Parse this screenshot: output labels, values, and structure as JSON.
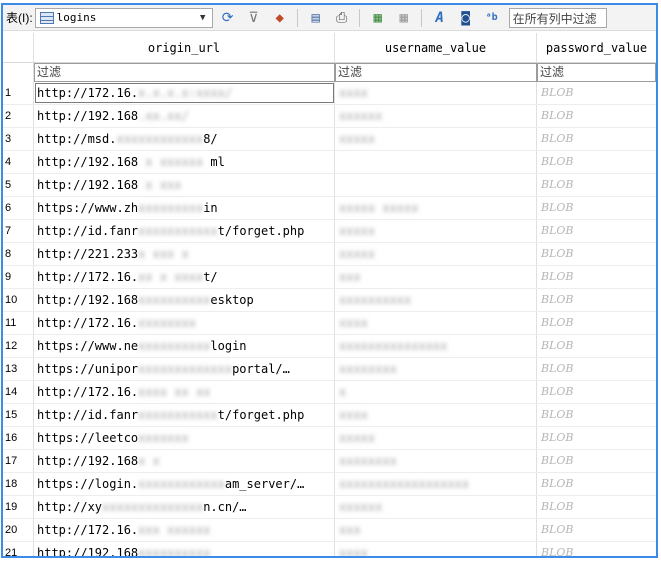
{
  "toolbar": {
    "table_label": "表(I):",
    "table_name": "logins",
    "filter_all_placeholder": "在所有列中过滤",
    "icons": [
      "refresh-icon",
      "clear-filter-icon",
      "save-filter-icon",
      "print-preview-icon",
      "print-icon",
      "new-record-icon",
      "delete-record-icon",
      "text-style-icon",
      "export-icon",
      "find-icon"
    ]
  },
  "grid": {
    "columns": [
      "origin_url",
      "username_value",
      "password_value"
    ],
    "filter_placeholder": "过滤",
    "rows": [
      {
        "id": "1",
        "origin_url": "http://172.16.",
        "origin_url_blur": "x.x.x.x:xxxx/",
        "username": "xxxx",
        "password": "BLOB"
      },
      {
        "id": "2",
        "origin_url": "http://192.168",
        "origin_url_blur": ".xx.xx/",
        "username": "xxxxxx",
        "password": "BLOB"
      },
      {
        "id": "3",
        "origin_url": "http://msd.",
        "origin_url_blur": "xxxxxxxxxxxx",
        "origin_url_tail": "8/",
        "username": "xxxxx",
        "password": "BLOB"
      },
      {
        "id": "4",
        "origin_url": "http://192.168",
        "origin_url_blur": " x xxxxxx ",
        "origin_url_tail": "ml",
        "username": "",
        "password": "BLOB"
      },
      {
        "id": "5",
        "origin_url": "http://192.168",
        "origin_url_blur": " x xxx",
        "username": "",
        "password": "BLOB"
      },
      {
        "id": "6",
        "origin_url": "https://www.zh",
        "origin_url_blur": "xxxxxxxxx",
        "origin_url_tail": "in",
        "username": "xxxxx xxxxx",
        "password": "BLOB"
      },
      {
        "id": "7",
        "origin_url": "http://id.fanr",
        "origin_url_blur": "xxxxxxxxxxx",
        "origin_url_tail": "t/forget.php",
        "username": "xxxxx",
        "password": "BLOB"
      },
      {
        "id": "8",
        "origin_url": "http://221.233",
        "origin_url_blur": "x xxx x",
        "username": "xxxxx",
        "password": "BLOB"
      },
      {
        "id": "9",
        "origin_url": "http://172.16.",
        "origin_url_blur": "xx x xxxx",
        "origin_url_tail": "t/",
        "username": "xxx",
        "password": "BLOB"
      },
      {
        "id": "10",
        "origin_url": "http://192.168",
        "origin_url_blur": "xxxxxxxxxx",
        "origin_url_tail": "esktop",
        "username": "xxxxxxxxxx",
        "password": "BLOB"
      },
      {
        "id": "11",
        "origin_url": "http://172.16.",
        "origin_url_blur": "xxxxxxxx",
        "username": "xxxx",
        "password": "BLOB"
      },
      {
        "id": "12",
        "origin_url": "https://www.ne",
        "origin_url_blur": "xxxxxxxxxx",
        "origin_url_tail": "login",
        "username": "xxxxxxxxxxxxxxx",
        "password": "BLOB"
      },
      {
        "id": "13",
        "origin_url": "https://unipor",
        "origin_url_blur": "xxxxxxxxxxxxx",
        "origin_url_tail": "portal/…",
        "username": "xxxxxxxx",
        "password": "BLOB"
      },
      {
        "id": "14",
        "origin_url": "http://172.16.",
        "origin_url_blur": "xxxx xx xx",
        "username": "x",
        "password": "BLOB"
      },
      {
        "id": "15",
        "origin_url": "http://id.fanr",
        "origin_url_blur": "xxxxxxxxxxx",
        "origin_url_tail": "t/forget.php",
        "username": "xxxx",
        "password": "BLOB"
      },
      {
        "id": "16",
        "origin_url": "https://leetco",
        "origin_url_blur": "xxxxxxx",
        "username": "xxxxx",
        "password": "BLOB"
      },
      {
        "id": "17",
        "origin_url": "http://192.168",
        "origin_url_blur": "x x",
        "username": "xxxxxxxx",
        "password": "BLOB"
      },
      {
        "id": "18",
        "origin_url": "https://login.",
        "origin_url_blur": "xxxxxxxxxxxx",
        "origin_url_tail": "am_server/…",
        "username": "xxxxxxxxxxxxxxxxxx",
        "password": "BLOB"
      },
      {
        "id": "19",
        "origin_url": "http://xy",
        "origin_url_blur": "xxxxxxxxxxxxxx",
        "origin_url_tail": "n.cn/…",
        "username": "xxxxxx",
        "password": "BLOB"
      },
      {
        "id": "20",
        "origin_url": "http://172.16.",
        "origin_url_blur": "xxx xxxxxx",
        "username": "xxx",
        "password": "BLOB"
      },
      {
        "id": "21",
        "origin_url": "http://192.168",
        "origin_url_blur": "xxxxxxxxxx",
        "username": "xxxx",
        "password": "BLOB"
      }
    ]
  }
}
